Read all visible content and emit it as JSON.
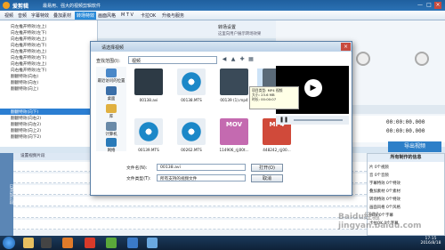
{
  "app": {
    "title": "爱剪辑",
    "subtitle": "最易用、强大的视频剪辑软件",
    "window_controls": [
      "—",
      "□",
      "×"
    ]
  },
  "menu": [
    "视频",
    "音频",
    "字幕特效",
    "叠加素材",
    "转场特效",
    "画面风格",
    "M T V",
    "卡拉OK",
    "升级与服务"
  ],
  "menu_active_index": 4,
  "left_list": [
    "向左推开特效(左上)",
    "向左推开特效(左下)",
    "向右推开特效(右上)",
    "向右推开特效(右下)",
    "向左推开特效(右上)",
    "向左推开特效(右下)",
    "向右推开特效(左上)",
    "向右推开特效(左下)",
    "翻翻特效(向右)",
    "翻翻特效(向左)",
    "翻翻特效(向上)",
    "翻翻特效(向下)",
    "翻翻特效(向右2)",
    "翻翻特效(向左2)",
    "翻翻特效(向上2)",
    "翻翻特效(向下2)"
  ],
  "left_list_selected": 11,
  "mid_header": "转场设置",
  "mid_note": "这里向用户展示转场效果",
  "right_pane": {
    "timer_left": "00:00:00.000",
    "timer_right": "00:00:00.000",
    "export_label": "导出视频"
  },
  "track_header": "已添加片段",
  "settings_bar": "设置视频片段",
  "info_panel": {
    "title": "所有制作的信息",
    "rows": [
      [
        "片",
        "0个视频"
      ],
      [
        "音",
        "0个音频"
      ],
      [
        "字幕特效",
        "0个特效"
      ],
      [
        "叠加素材",
        "0个素材"
      ],
      [
        "转场特效",
        "0个特效"
      ],
      [
        "画面风格",
        "0个风格"
      ],
      [
        "MTV",
        "0个字幕"
      ],
      [
        "卡拉OK",
        "0个字幕"
      ]
    ]
  },
  "dialog": {
    "title": "请选择视频",
    "look_in_label": "查找范围(I):",
    "look_in_value": "视频",
    "places": [
      "最近访问的位置",
      "桌面",
      "库",
      "计算机",
      "网络"
    ],
    "files": [
      {
        "name": "00138.avi",
        "kind": "video",
        "color": "#2d3a45"
      },
      {
        "name": "00138.MTS",
        "kind": "disc",
        "color": "#1c88c8"
      },
      {
        "name": "00139 (1).mp4",
        "kind": "video",
        "color": "#3a4a58"
      },
      {
        "name": "00139 (2).mp4",
        "kind": "video",
        "color": "#5a6a78"
      },
      {
        "name": "00139.MTS",
        "kind": "disc",
        "color": "#1c88c8"
      },
      {
        "name": "00262.MTS",
        "kind": "disc",
        "color": "#1c88c8"
      },
      {
        "name": "114906_rjj00t...",
        "kind": "mov",
        "color": "#c46ab0"
      },
      {
        "name": "448242_rjj00...",
        "kind": "mp4",
        "color": "#d04a3a"
      }
    ],
    "tooltip": [
      "项目类型: MP4 视频",
      "大小: 23.6 MB",
      "时长: 00:00:07"
    ],
    "filename_label": "文件名(N):",
    "filename_value": "00138.avi",
    "filetype_label": "文件类型(T):",
    "filetype_value": "所有支持的视频文件",
    "open_label": "打开(O)",
    "cancel_label": "取消"
  },
  "taskbar": {
    "time": "17:15",
    "date": "2016/8/18"
  },
  "watermark": "Baidu经验 jingyan.baidu.com"
}
